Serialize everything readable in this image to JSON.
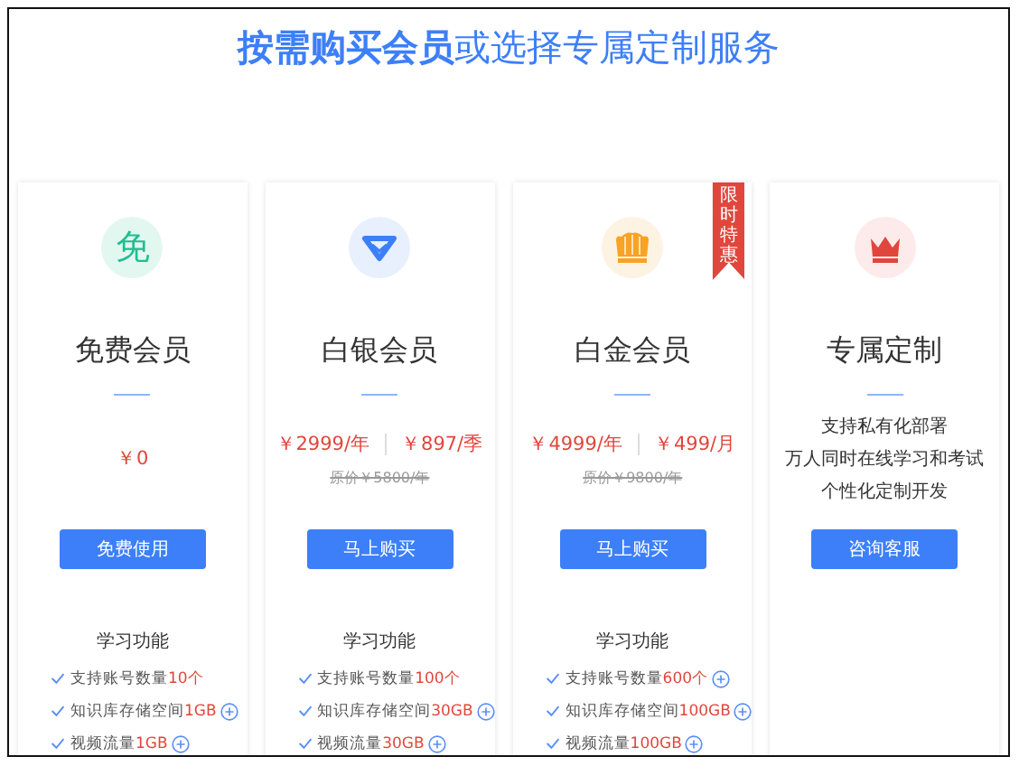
{
  "title": "**按需购买会员**或选择专属定制服务",
  "plans": [
    {
      "name": "免费会员",
      "icon": {
        "kind": "glyph",
        "text": "免"
      },
      "prices": [
        "￥0"
      ],
      "button": "免费使用",
      "features_title": "学习功能",
      "features": [
        {
          "label": "支持账号数量",
          "value": "10个",
          "addable": false
        },
        {
          "label": "知识库存储空间",
          "value": "1GB",
          "addable": true
        },
        {
          "label": "视频流量",
          "value": "1GB",
          "addable": true
        }
      ]
    },
    {
      "name": "白银会员",
      "icon": {
        "kind": "diamond"
      },
      "prices": [
        "￥2999/年",
        "￥897/季"
      ],
      "original_price": "原价￥5800/年",
      "button": "马上购买",
      "features_title": "学习功能",
      "features": [
        {
          "label": "支持账号数量",
          "value": "100个",
          "addable": false
        },
        {
          "label": "知识库存储空间",
          "value": "30GB",
          "addable": true
        },
        {
          "label": "视频流量",
          "value": "30GB",
          "addable": true
        }
      ]
    },
    {
      "name": "白金会员",
      "icon": {
        "kind": "crown"
      },
      "ribbon": "限时特惠",
      "prices": [
        "￥4999/年",
        "￥499/月"
      ],
      "original_price": "原价￥9800/年",
      "button": "马上购买",
      "features_title": "学习功能",
      "features": [
        {
          "label": "支持账号数量",
          "value": "600个",
          "addable": true
        },
        {
          "label": "知识库存储空间",
          "value": "100GB",
          "addable": true
        },
        {
          "label": "视频流量",
          "value": "100GB",
          "addable": true
        }
      ]
    },
    {
      "name": "专属定制",
      "icon": {
        "kind": "red-crown"
      },
      "description": [
        "支持私有化部署",
        "万人同时在线学习和考试",
        "个性化定制开发"
      ],
      "button": "咨询客服"
    }
  ]
}
